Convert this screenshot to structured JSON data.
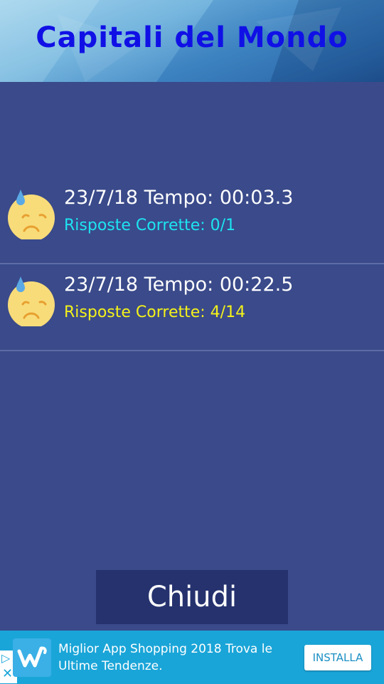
{
  "header": {
    "title": "Capitali del Mondo"
  },
  "results": [
    {
      "icon": "sad-sweat-face-icon",
      "line1": "23/7/18 Tempo: 00:03.3",
      "line2": "Risposte Corrette: 0/1",
      "line2_color": "#1de4f2"
    },
    {
      "icon": "sad-sweat-face-icon",
      "line1": "23/7/18 Tempo: 00:22.5",
      "line2": "Risposte Corrette: 4/14",
      "line2_color": "#f4f21a"
    }
  ],
  "close_button": {
    "label": "Chiudi"
  },
  "ad": {
    "text": "Miglior App Shopping 2018 Trova le Ultime Tendenze.",
    "install_label": "INSTALLA",
    "logo_icon": "wish-logo-icon",
    "adchoices_icons": [
      "play-icon",
      "close-icon"
    ]
  },
  "colors": {
    "background": "#3a4a8a",
    "title": "#1010e6",
    "button": "#25326e",
    "ad_background": "#1aa5d8"
  }
}
